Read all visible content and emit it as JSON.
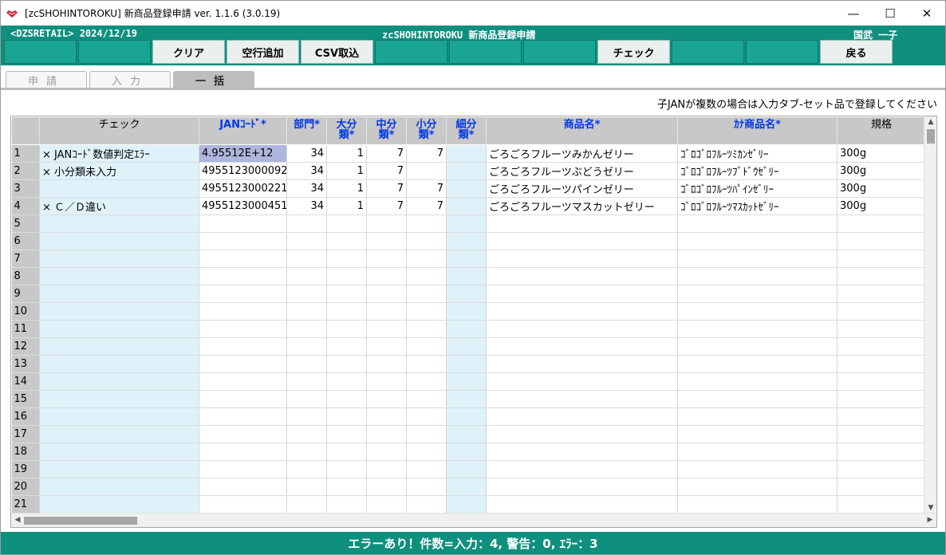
{
  "window": {
    "title": "[zcSHOHINTOROKU] 新商品登録申請 ver. 1.1.6 (3.0.19)",
    "minimize": "—",
    "maximize": "☐",
    "close": "✕"
  },
  "header": {
    "left": "<DZSRETAIL>  2024/12/19",
    "center": "zcSHOHINTOROKU  新商品登録申請",
    "right": "国武  一子"
  },
  "buttons": {
    "clear": "クリア",
    "add_row": "空行追加",
    "csv": "CSV取込",
    "check": "チェック",
    "back": "戻る"
  },
  "tabs": [
    "申請",
    "入力",
    "一括"
  ],
  "hint": "子JANが複数の場合は入力タブ-セット品で登録してください",
  "grid": {
    "headers": {
      "check": "チェック",
      "jan": "JANｺｰﾄﾞ*",
      "bumon": "部門*",
      "dai1": "大分",
      "dai2": "類*",
      "chu1": "中分",
      "chu2": "類*",
      "sho1": "小分",
      "sho2": "類*",
      "sai1": "細分",
      "sai2": "類*",
      "name": "商品名*",
      "kana": "ｶﾅ商品名*",
      "kikaku": "規格"
    },
    "rows": [
      {
        "no": "1",
        "check": "× JANｺｰﾄﾞ数値判定ｴﾗｰ",
        "jan": "4.95512E+12",
        "bumon": "34",
        "dai": "1",
        "chu": "7",
        "sho": "7",
        "sai": "",
        "name": "ごろごろフルーツみかんゼリー",
        "kana": "ｺﾞﾛｺﾞﾛﾌﾙｰﾂﾐｶﾝｾﾞﾘｰ",
        "kikaku": "300g"
      },
      {
        "no": "2",
        "check": "× 小分類未入力",
        "jan": "4955123000092",
        "bumon": "34",
        "dai": "1",
        "chu": "7",
        "sho": "",
        "sai": "",
        "name": "ごろごろフルーツぶどうゼリー",
        "kana": "ｺﾞﾛｺﾞﾛﾌﾙｰﾂﾌﾞﾄﾞｳｾﾞﾘｰ",
        "kikaku": "300g"
      },
      {
        "no": "3",
        "check": "",
        "jan": "4955123000221",
        "bumon": "34",
        "dai": "1",
        "chu": "7",
        "sho": "7",
        "sai": "",
        "name": "ごろごろフルーツパインゼリー",
        "kana": "ｺﾞﾛｺﾞﾛﾌﾙｰﾂﾊﾟｲﾝｾﾞﾘｰ",
        "kikaku": "300g"
      },
      {
        "no": "4",
        "check": "× Ｃ／Ｄ違い",
        "jan": "4955123000451",
        "bumon": "34",
        "dai": "1",
        "chu": "7",
        "sho": "7",
        "sai": "",
        "name": "ごろごろフルーツマスカットゼリー",
        "kana": "ｺﾞﾛｺﾞﾛﾌﾙｰﾂﾏｽｶｯﾄｾﾞﾘｰ",
        "kikaku": "300g"
      },
      {
        "no": "5",
        "check": "",
        "jan": "",
        "bumon": "",
        "dai": "",
        "chu": "",
        "sho": "",
        "sai": "",
        "name": "",
        "kana": "",
        "kikaku": ""
      },
      {
        "no": "6",
        "check": "",
        "jan": "",
        "bumon": "",
        "dai": "",
        "chu": "",
        "sho": "",
        "sai": "",
        "name": "",
        "kana": "",
        "kikaku": ""
      },
      {
        "no": "7",
        "check": "",
        "jan": "",
        "bumon": "",
        "dai": "",
        "chu": "",
        "sho": "",
        "sai": "",
        "name": "",
        "kana": "",
        "kikaku": ""
      },
      {
        "no": "8",
        "check": "",
        "jan": "",
        "bumon": "",
        "dai": "",
        "chu": "",
        "sho": "",
        "sai": "",
        "name": "",
        "kana": "",
        "kikaku": ""
      },
      {
        "no": "9",
        "check": "",
        "jan": "",
        "bumon": "",
        "dai": "",
        "chu": "",
        "sho": "",
        "sai": "",
        "name": "",
        "kana": "",
        "kikaku": ""
      },
      {
        "no": "10",
        "check": "",
        "jan": "",
        "bumon": "",
        "dai": "",
        "chu": "",
        "sho": "",
        "sai": "",
        "name": "",
        "kana": "",
        "kikaku": ""
      },
      {
        "no": "11",
        "check": "",
        "jan": "",
        "bumon": "",
        "dai": "",
        "chu": "",
        "sho": "",
        "sai": "",
        "name": "",
        "kana": "",
        "kikaku": ""
      },
      {
        "no": "12",
        "check": "",
        "jan": "",
        "bumon": "",
        "dai": "",
        "chu": "",
        "sho": "",
        "sai": "",
        "name": "",
        "kana": "",
        "kikaku": ""
      },
      {
        "no": "13",
        "check": "",
        "jan": "",
        "bumon": "",
        "dai": "",
        "chu": "",
        "sho": "",
        "sai": "",
        "name": "",
        "kana": "",
        "kikaku": ""
      },
      {
        "no": "14",
        "check": "",
        "jan": "",
        "bumon": "",
        "dai": "",
        "chu": "",
        "sho": "",
        "sai": "",
        "name": "",
        "kana": "",
        "kikaku": ""
      },
      {
        "no": "15",
        "check": "",
        "jan": "",
        "bumon": "",
        "dai": "",
        "chu": "",
        "sho": "",
        "sai": "",
        "name": "",
        "kana": "",
        "kikaku": ""
      },
      {
        "no": "16",
        "check": "",
        "jan": "",
        "bumon": "",
        "dai": "",
        "chu": "",
        "sho": "",
        "sai": "",
        "name": "",
        "kana": "",
        "kikaku": ""
      },
      {
        "no": "17",
        "check": "",
        "jan": "",
        "bumon": "",
        "dai": "",
        "chu": "",
        "sho": "",
        "sai": "",
        "name": "",
        "kana": "",
        "kikaku": ""
      },
      {
        "no": "18",
        "check": "",
        "jan": "",
        "bumon": "",
        "dai": "",
        "chu": "",
        "sho": "",
        "sai": "",
        "name": "",
        "kana": "",
        "kikaku": ""
      },
      {
        "no": "19",
        "check": "",
        "jan": "",
        "bumon": "",
        "dai": "",
        "chu": "",
        "sho": "",
        "sai": "",
        "name": "",
        "kana": "",
        "kikaku": ""
      },
      {
        "no": "20",
        "check": "",
        "jan": "",
        "bumon": "",
        "dai": "",
        "chu": "",
        "sho": "",
        "sai": "",
        "name": "",
        "kana": "",
        "kikaku": ""
      },
      {
        "no": "21",
        "check": "",
        "jan": "",
        "bumon": "",
        "dai": "",
        "chu": "",
        "sho": "",
        "sai": "",
        "name": "",
        "kana": "",
        "kikaku": ""
      }
    ]
  },
  "status": "エラーあり！件数=入力：4, 警告：0, ｴﾗｰ：3",
  "colors": {
    "accent": "#0f8f7e",
    "error_cell": "#aeb5de",
    "header_text": "#0038e6",
    "check_column": "#dff2f9"
  }
}
